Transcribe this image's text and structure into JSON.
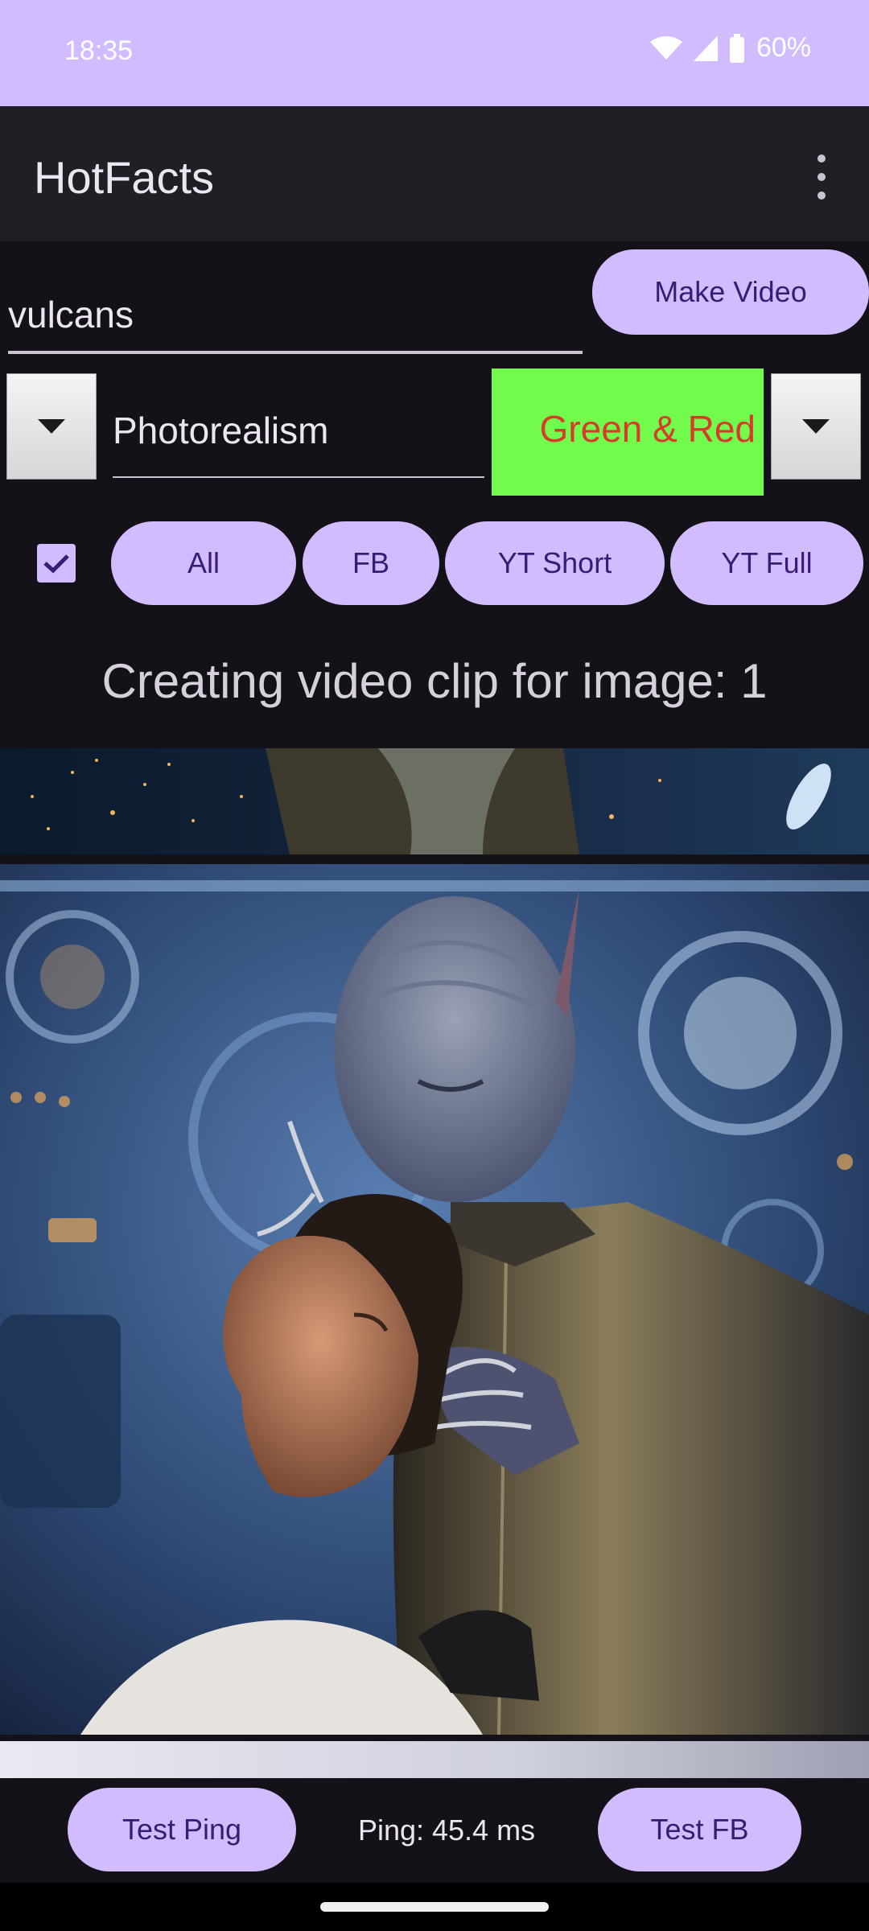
{
  "status_bar": {
    "time": "18:35",
    "battery": "60%",
    "bg_color": "#d0bcff"
  },
  "app_bar": {
    "title": "HotFacts",
    "menu_icon": "more-vert-icon"
  },
  "search": {
    "value": "vulcans"
  },
  "make_video": {
    "label": "Make Video"
  },
  "style": {
    "value": "Photorealism",
    "dropdown_icon": "arrow-drop-down-icon"
  },
  "color_scheme": {
    "label": "Green & Red",
    "bg_color": "#72fb4c",
    "text_color": "#d53d2a",
    "dropdown_icon": "arrow-drop-down-icon"
  },
  "platforms": {
    "checkbox_checked": true,
    "buttons": [
      "All",
      "FB",
      "YT Short",
      "YT Full"
    ]
  },
  "status_text": "Creating video clip for image: 1",
  "bottom": {
    "test_ping_label": "Test Ping",
    "ping_text": "Ping: 45.4 ms",
    "test_fb_label": "Test FB"
  },
  "colors": {
    "accent": "#d0bcff",
    "on_accent": "#381e72",
    "background": "#141218",
    "app_bar": "#211f26"
  }
}
